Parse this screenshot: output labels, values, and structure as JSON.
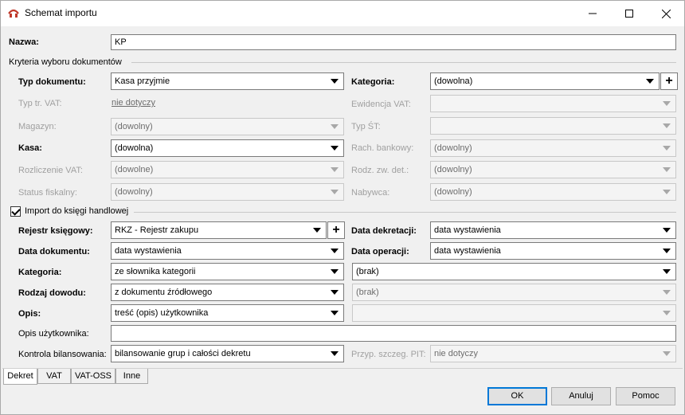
{
  "window": {
    "title": "Schemat importu"
  },
  "nazwa": {
    "label": "Nazwa:",
    "value": "KP"
  },
  "kryteria": {
    "header": "Kryteria wyboru dokumentów",
    "typ_dokumentu": {
      "label": "Typ dokumentu:",
      "value": "Kasa przyjmie"
    },
    "typ_tr_vat": {
      "label": "Typ tr. VAT:",
      "value": "nie dotyczy"
    },
    "magazyn": {
      "label": "Magazyn:",
      "value": "(dowolny)"
    },
    "kasa": {
      "label": "Kasa:",
      "value": "(dowolna)"
    },
    "rozliczenie_vat": {
      "label": "Rozliczenie VAT:",
      "value": "(dowolne)"
    },
    "status_fiskalny": {
      "label": "Status fiskalny:",
      "value": "(dowolny)"
    },
    "kategoria": {
      "label": "Kategoria:",
      "value": "(dowolna)"
    },
    "ewidencja_vat": {
      "label": "Ewidencja VAT:",
      "value": ""
    },
    "typ_st": {
      "label": "Typ ŚT:",
      "value": ""
    },
    "rach_bankowy": {
      "label": "Rach. bankowy:",
      "value": "(dowolny)"
    },
    "rodz_zw_det": {
      "label": "Rodz. zw. det.:",
      "value": "(dowolny)"
    },
    "nabywca": {
      "label": "Nabywca:",
      "value": "(dowolny)"
    }
  },
  "import": {
    "checkbox_label": "Import do księgi handlowej",
    "checked": true,
    "rejestr": {
      "label": "Rejestr księgowy:",
      "value": "RKZ - Rejestr zakupu"
    },
    "data_dokumentu": {
      "label": "Data dokumentu:",
      "value": "data wystawienia"
    },
    "kategoria": {
      "label": "Kategoria:",
      "value": "ze słownika kategorii"
    },
    "rodzaj_dowodu": {
      "label": "Rodzaj dowodu:",
      "value": "z dokumentu źródłowego"
    },
    "opis": {
      "label": "Opis:",
      "value": "treść (opis) użytkownika"
    },
    "opis_uzytkownika": {
      "label": "Opis użytkownika:",
      "value": ""
    },
    "kontrola": {
      "label": "Kontrola bilansowania:",
      "value": "bilansowanie grup i całości dekretu"
    },
    "data_dekretacji": {
      "label": "Data dekretacji:",
      "value": "data wystawienia"
    },
    "data_operacji": {
      "label": "Data operacji:",
      "value": "data wystawienia"
    },
    "kategoria_right": {
      "value": "(brak)"
    },
    "rodzaj_right": {
      "value": "(brak)"
    },
    "opis_right": {
      "value": ""
    },
    "przyp_pit": {
      "label": "Przyp. szczeg. PIT:",
      "value": "nie dotyczy"
    }
  },
  "tabs": [
    "Dekret",
    "VAT",
    "VAT-OSS",
    "Inne"
  ],
  "buttons": {
    "ok": "OK",
    "cancel": "Anuluj",
    "help": "Pomoc"
  },
  "colors": {
    "accent": "#0078d7",
    "disabled_text": "#a0a0a0"
  }
}
